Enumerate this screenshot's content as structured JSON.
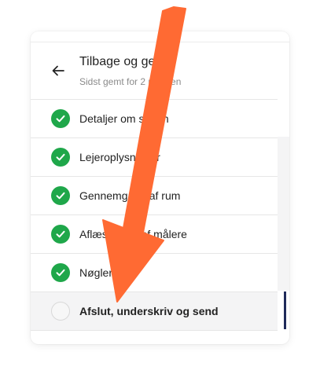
{
  "header": {
    "title": "Tilbage og gem",
    "subtitle": "Sidst gemt for 2 m siden"
  },
  "steps": [
    {
      "label": "Detaljer om sagen",
      "status": "done"
    },
    {
      "label": "Lejeroplysninger",
      "status": "done"
    },
    {
      "label": "Gennemgang af rum",
      "status": "done"
    },
    {
      "label": "Aflæsninger af målere",
      "status": "done"
    },
    {
      "label": "Nøgler",
      "status": "done"
    },
    {
      "label": "Afslut, underskriv og send",
      "status": "current"
    }
  ],
  "colors": {
    "check_green": "#1fa74a",
    "arrow_orange": "#ff6a33",
    "active_indicator": "#1f2a5a",
    "active_bg": "#f4f4f5"
  },
  "icons": {
    "back": "arrow-left-icon",
    "done": "checkmark-icon",
    "pending": "empty-circle-icon",
    "annotation": "annotation-arrow"
  }
}
